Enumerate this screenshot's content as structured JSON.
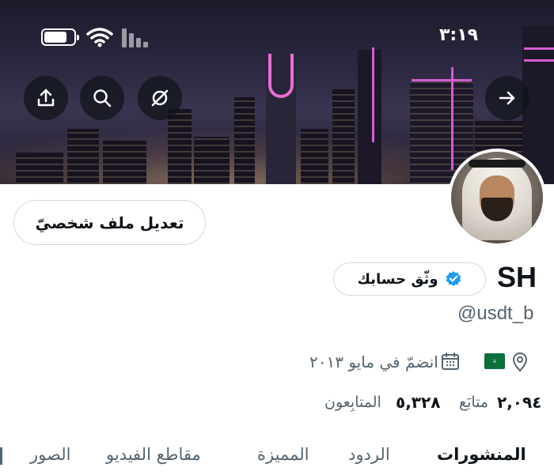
{
  "status_bar": {
    "time": "٣:١٩"
  },
  "header": {
    "buttons": [
      {
        "name": "upload-icon"
      },
      {
        "name": "search-icon"
      },
      {
        "name": "grok-icon"
      }
    ],
    "back_icon": "arrow-right-icon"
  },
  "profile": {
    "edit_button_label": "تعديل ملف شخصيّ",
    "display_name": "SH",
    "verify_button_label": "وثّق حسابك",
    "handle": "@usdt_b",
    "joined": "انضمّ في مايو ٢٠١٣",
    "following_count": "٢,٠٩٤",
    "following_label": "متابَع",
    "followers_count": "٥,٣٢٨",
    "followers_label": "المتابِعون"
  },
  "tabs": [
    {
      "label": "المنشورات",
      "active": true
    },
    {
      "label": "الردود",
      "active": false
    },
    {
      "label": "المميزة",
      "active": false
    },
    {
      "label": "مقاطع الفيديو",
      "active": false
    },
    {
      "label": "الصور",
      "active": false
    }
  ],
  "colors": {
    "text_primary": "#0f1419",
    "text_secondary": "#536471",
    "verified_blue": "#1d9bf0",
    "border": "#cfd9de"
  }
}
